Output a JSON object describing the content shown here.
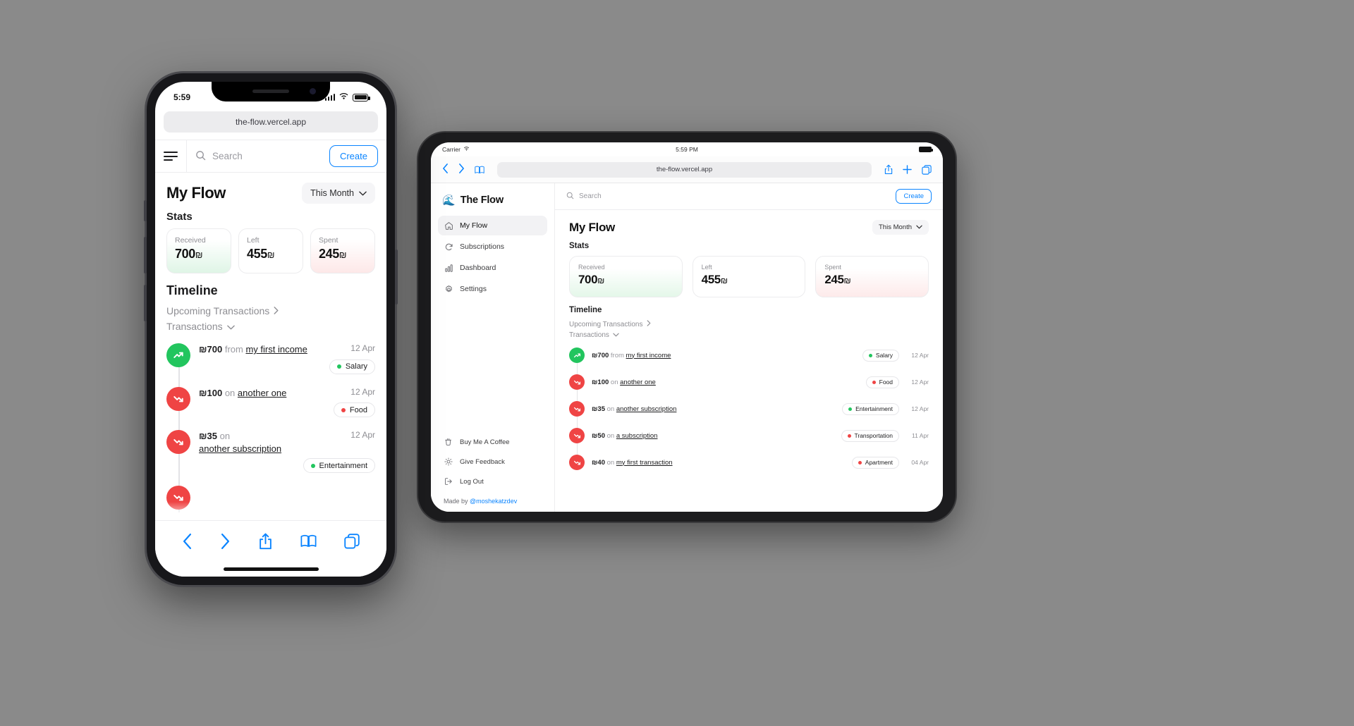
{
  "colors": {
    "accent": "#0a84ff",
    "income": "#22c55e",
    "expense": "#ef4444",
    "received_bg": "#e4f7e9",
    "spent_bg": "#fdeaea"
  },
  "phone": {
    "status": {
      "time": "5:59",
      "signal_icon": "cellular-bars-icon",
      "wifi_icon": "wifi-icon",
      "battery_icon": "battery-icon"
    },
    "browser": {
      "url": "the-flow.vercel.app"
    },
    "appbar": {
      "menu_icon": "hamburger-menu-icon",
      "search_icon": "search-icon",
      "search_placeholder": "Search",
      "create_label": "Create"
    },
    "page_title": "My Flow",
    "period": {
      "label": "This Month",
      "chevron": "chevron-down-icon"
    },
    "stats_heading": "Stats",
    "stats": [
      {
        "label": "Received",
        "value": "700",
        "currency": "₪",
        "tone": "green"
      },
      {
        "label": "Left",
        "value": "455",
        "currency": "₪",
        "tone": "plain"
      },
      {
        "label": "Spent",
        "value": "245",
        "currency": "₪",
        "tone": "red"
      }
    ],
    "timeline_heading": "Timeline",
    "upcoming_label": "Upcoming Transactions",
    "upcoming_chevron": "chevron-right-icon",
    "transactions_label": "Transactions",
    "transactions_chevron": "chevron-down-icon",
    "transactions": [
      {
        "type": "income",
        "icon": "trend-up-icon",
        "currency": "₪",
        "amount": "700",
        "preposition": "from",
        "party": "my first income",
        "category": "Salary",
        "category_color": "#22c55e",
        "date": "12 Apr"
      },
      {
        "type": "expense",
        "icon": "trend-down-icon",
        "currency": "₪",
        "amount": "100",
        "preposition": "on",
        "party": "another one",
        "category": "Food",
        "category_color": "#ef4444",
        "date": "12 Apr"
      },
      {
        "type": "expense",
        "icon": "trend-down-icon",
        "currency": "₪",
        "amount": "35",
        "preposition": "on",
        "party": "another subscription",
        "category": "Entertainment",
        "category_color": "#22c55e",
        "date": "12 Apr"
      }
    ],
    "tabbar": [
      {
        "name": "back-button",
        "icon": "chevron-left-icon"
      },
      {
        "name": "forward-button",
        "icon": "chevron-right-icon"
      },
      {
        "name": "share-button",
        "icon": "share-icon"
      },
      {
        "name": "bookmarks-button",
        "icon": "book-icon"
      },
      {
        "name": "tabs-button",
        "icon": "tabs-icon"
      }
    ]
  },
  "tablet": {
    "status": {
      "carrier": "Carrier",
      "wifi_icon": "wifi-icon",
      "time": "5:59 PM",
      "battery_icon": "battery-icon"
    },
    "browser": {
      "back_icon": "chevron-left-icon",
      "forward_icon": "chevron-right-icon",
      "bookmarks_icon": "book-icon",
      "url": "the-flow.vercel.app",
      "share_icon": "share-icon",
      "newtab_icon": "plus-icon",
      "tabs_icon": "tabs-icon"
    },
    "brand": {
      "logo": "🌊",
      "name": "The Flow"
    },
    "sidebar": {
      "items": [
        {
          "label": "My Flow",
          "icon": "home-icon",
          "active": true
        },
        {
          "label": "Subscriptions",
          "icon": "refresh-icon",
          "active": false
        },
        {
          "label": "Dashboard",
          "icon": "bar-chart-icon",
          "active": false
        },
        {
          "label": "Settings",
          "icon": "gear-icon",
          "active": false
        }
      ],
      "footer_items": [
        {
          "label": "Buy Me A Coffee",
          "icon": "coffee-cup-icon"
        },
        {
          "label": "Give Feedback",
          "icon": "sun-icon"
        },
        {
          "label": "Log Out",
          "icon": "logout-icon"
        }
      ],
      "made_by_prefix": "Made by ",
      "made_by_handle": "@moshekatzdev"
    },
    "topbar": {
      "search_icon": "search-icon",
      "search_placeholder": "Search",
      "create_label": "Create"
    },
    "page_title": "My Flow",
    "period": {
      "label": "This Month",
      "chevron": "chevron-down-icon"
    },
    "stats_heading": "Stats",
    "stats": [
      {
        "label": "Received",
        "value": "700",
        "currency": "₪",
        "tone": "green"
      },
      {
        "label": "Left",
        "value": "455",
        "currency": "₪",
        "tone": "plain"
      },
      {
        "label": "Spent",
        "value": "245",
        "currency": "₪",
        "tone": "red"
      }
    ],
    "timeline_heading": "Timeline",
    "upcoming_label": "Upcoming Transactions",
    "upcoming_chevron": "chevron-right-icon",
    "transactions_label": "Transactions",
    "transactions_chevron": "chevron-down-icon",
    "transactions": [
      {
        "type": "income",
        "icon": "trend-up-icon",
        "currency": "₪",
        "amount": "700",
        "preposition": "from",
        "party": "my first income",
        "category": "Salary",
        "category_color": "#22c55e",
        "date": "12 Apr"
      },
      {
        "type": "expense",
        "icon": "trend-down-icon",
        "currency": "₪",
        "amount": "100",
        "preposition": "on",
        "party": "another one",
        "category": "Food",
        "category_color": "#ef4444",
        "date": "12 Apr"
      },
      {
        "type": "expense",
        "icon": "trend-down-icon",
        "currency": "₪",
        "amount": "35",
        "preposition": "on",
        "party": "another subscription",
        "category": "Entertainment",
        "category_color": "#22c55e",
        "date": "12 Apr"
      },
      {
        "type": "expense",
        "icon": "trend-down-icon",
        "currency": "₪",
        "amount": "50",
        "preposition": "on",
        "party": "a subscription",
        "category": "Transportation",
        "category_color": "#ef4444",
        "date": "11 Apr"
      },
      {
        "type": "expense",
        "icon": "trend-down-icon",
        "currency": "₪",
        "amount": "40",
        "preposition": "on",
        "party": "my first transaction",
        "category": "Apartment",
        "category_color": "#ef4444",
        "date": "04 Apr"
      }
    ]
  }
}
